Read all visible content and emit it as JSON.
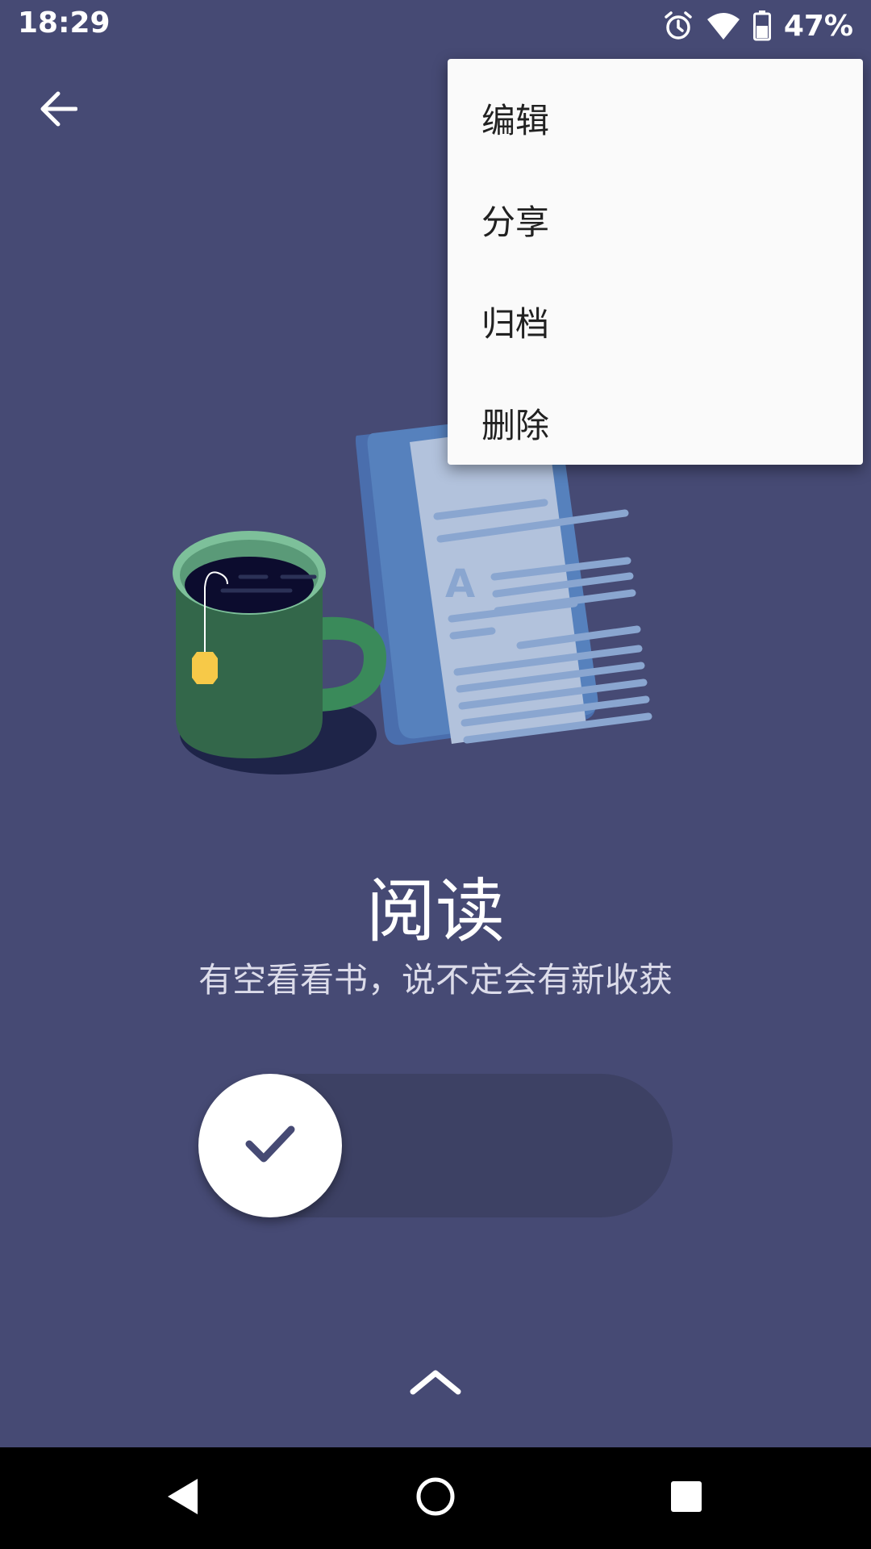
{
  "status_bar": {
    "time": "18:29",
    "battery_percent": "47%",
    "icons": [
      "alarm-icon",
      "wifi-icon",
      "battery-icon"
    ]
  },
  "header": {
    "back_icon": "arrow-left-icon"
  },
  "content": {
    "title": "阅读",
    "subtitle": "有空看看书，说不定会有新收获",
    "illustration_letter": "A"
  },
  "swipe_control": {
    "knob_icon": "checkmark-icon"
  },
  "menu": {
    "items": [
      {
        "label": "编辑"
      },
      {
        "label": "分享"
      },
      {
        "label": "归档"
      },
      {
        "label": "删除"
      }
    ]
  },
  "nav_bar": {
    "icons": [
      "back-triangle-icon",
      "home-circle-icon",
      "recents-square-icon"
    ]
  },
  "colors": {
    "background": "#464a74",
    "menu_background": "#fafafa",
    "track": "#3d4164",
    "mug": "#33674a",
    "tablet": "#5681bd",
    "tag": "#f7c948"
  }
}
